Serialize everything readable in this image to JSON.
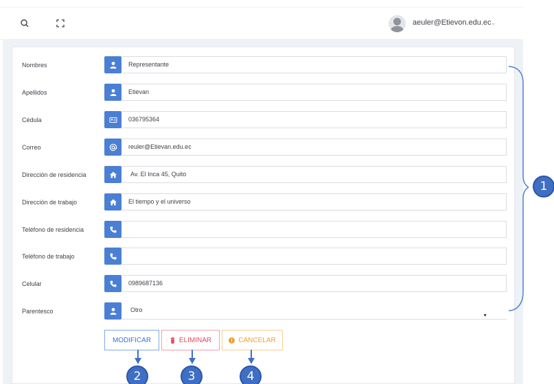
{
  "header": {
    "user_email": "aeuler@Etievon.edu.ec",
    "caret": "⌄"
  },
  "form": {
    "fields": [
      {
        "label": "Nombres",
        "icon": "user-icon",
        "value": ""
      },
      {
        "label": "Apellidos",
        "icon": "user-icon",
        "value": "Etievan"
      },
      {
        "label": "Cédula",
        "icon": "id-card-icon",
        "value": "036795364"
      },
      {
        "label": "Correo",
        "icon": "at-icon",
        "value": "reuler@Etievan.edu.ec"
      },
      {
        "label": "Dirección de residencia",
        "icon": "home-icon",
        "value": "Av. El Inca 45, Quito"
      },
      {
        "label": "Dirección de trabajo",
        "icon": "home-icon",
        "value": "El tiempo y el universo"
      },
      {
        "label": "Teléfono de residencia",
        "icon": "phone-icon",
        "value": ""
      },
      {
        "label": "Teléfono de trabajo",
        "icon": "phone-icon",
        "value": ""
      },
      {
        "label": "Celular",
        "icon": "phone-icon",
        "value": "0989687136"
      },
      {
        "label": "Parentesco",
        "icon": "user-icon",
        "value": "Otro"
      }
    ],
    "nombres_value": "Representante",
    "select_caret": "▼"
  },
  "buttons": {
    "modificar": "MODIFICAR",
    "eliminar": "ELIMINAR",
    "cancelar": "CANCELAR"
  },
  "annotations": [
    "1",
    "2",
    "3",
    "4"
  ],
  "colors": {
    "accent": "#4a7fd4",
    "marker": "#3f6fc4",
    "delete": "#e2475f",
    "cancel": "#f0a030"
  }
}
